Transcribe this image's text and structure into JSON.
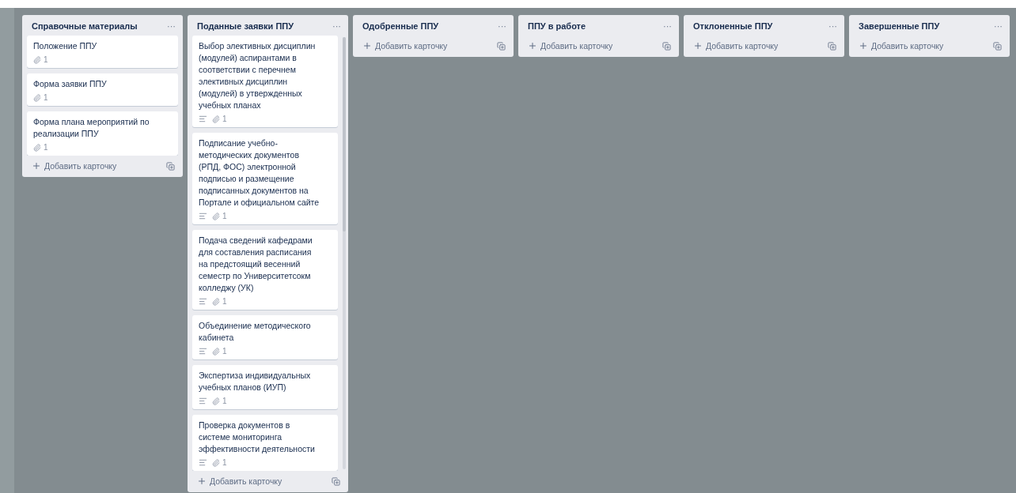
{
  "lists": [
    {
      "title": "Справочные материалы",
      "menu": "···",
      "add_label": "Добавить карточку",
      "cards": [
        {
          "title": "Положение ППУ",
          "description": false,
          "attachments": "1"
        },
        {
          "title": "Форма заявки ППУ",
          "description": false,
          "attachments": "1"
        },
        {
          "title": "Форма плана мероприятий по реализации ППУ",
          "description": false,
          "attachments": "1"
        }
      ]
    },
    {
      "title": "Поданные заявки ППУ",
      "menu": "···",
      "add_label": "Добавить карточку",
      "scrollbar": true,
      "cards": [
        {
          "title": "Выбор элективных дисциплин (модулей) аспирантами в соответствии с перечнем элективных дисциплин (модулей) в утвержденных учебных планах",
          "description": true,
          "attachments": "1"
        },
        {
          "title": "Подписание учебно-методических документов (РПД, ФОС) электронной подписью и размещение подписанных документов на Портале и официальном сайте",
          "description": true,
          "attachments": "1"
        },
        {
          "title": "Подача сведений кафедрами для составления расписания на предстоящий весенний семестр по Университетсокм колледжу (УК)",
          "description": true,
          "attachments": "1"
        },
        {
          "title": "Объединение методического кабинета",
          "description": true,
          "attachments": "1"
        },
        {
          "title": "Экспертиза индивидуальных учебных планов (ИУП)",
          "description": true,
          "attachments": "1"
        },
        {
          "title": "Проверка документов в системе мониторинга эффективности деятельности",
          "description": true,
          "attachments": "1"
        }
      ]
    },
    {
      "title": "Одобренные ППУ",
      "menu": "···",
      "add_label": "Добавить карточку"
    },
    {
      "title": "ППУ в работе",
      "menu": "···",
      "add_label": "Добавить карточку"
    },
    {
      "title": "Отклоненные ППУ",
      "menu": "···",
      "add_label": "Добавить карточку"
    },
    {
      "title": "Завершенные ППУ",
      "menu": "···",
      "add_label": "Добавить карточку"
    }
  ]
}
